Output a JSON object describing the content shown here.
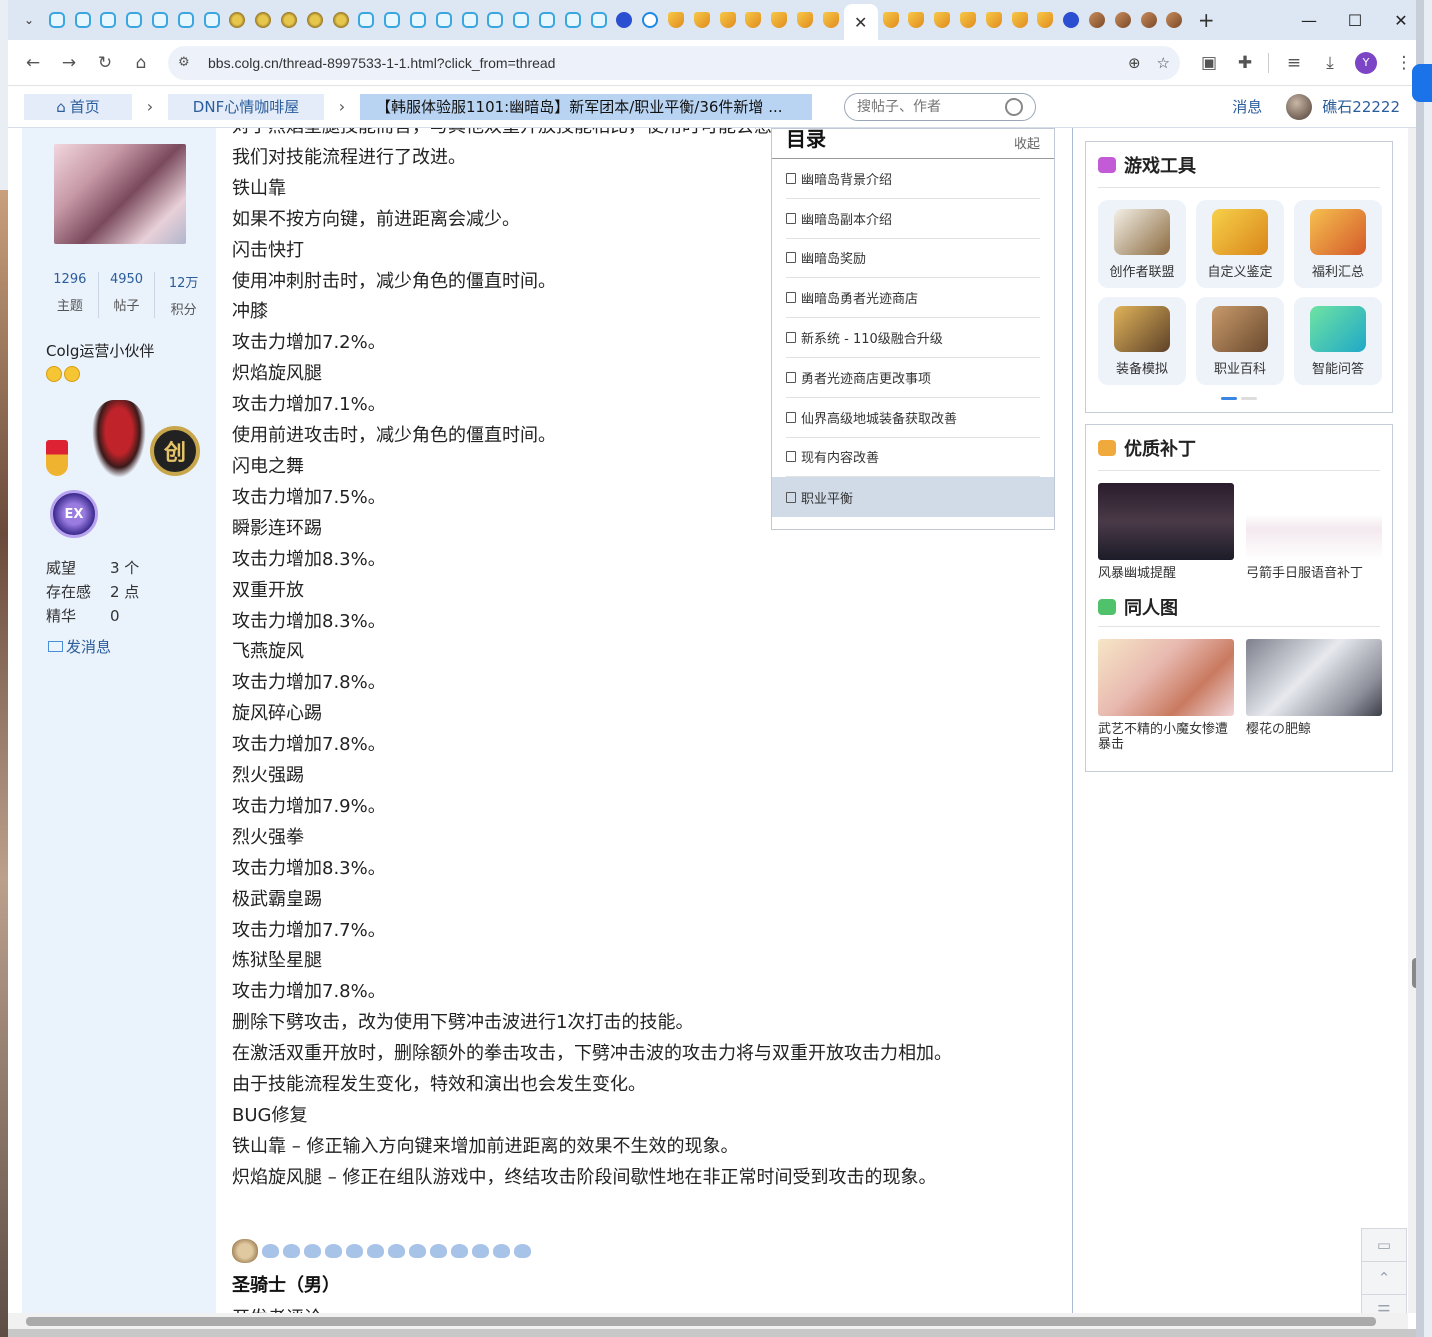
{
  "browser": {
    "tab_favicons": [
      "bili",
      "bili",
      "bili",
      "bili",
      "bili",
      "bili",
      "bili",
      "colg",
      "colg",
      "colg",
      "colg",
      "colg",
      "bili",
      "bili",
      "bili",
      "bili",
      "bili",
      "bili",
      "bili",
      "bili",
      "bili",
      "bili",
      "paw",
      "search",
      "cup",
      "cup",
      "cup",
      "cup",
      "cup",
      "cup",
      "cup"
    ],
    "tab_favicons_after": [
      "cup",
      "cup",
      "cup",
      "cup",
      "cup",
      "cup",
      "cup",
      "paw",
      "bread",
      "bread",
      "bread",
      "bread"
    ],
    "new_tab_label": "+",
    "url": "bbs.colg.cn/thread-8997533-1-1.html?click_from=thread",
    "profile_initial": "Y"
  },
  "sitenav": {
    "home_label": "首页",
    "forum_label": "DNF心情咖啡屋",
    "thread_label": "【韩服体验服1101:幽暗岛】新军团本/职业平衡/36件新增 ...",
    "search_placeholder": "搜帖子、作者",
    "messages_label": "消息",
    "username": "礁石22222"
  },
  "profile": {
    "stats": [
      {
        "value": "1296",
        "label": "主题"
      },
      {
        "value": "4950",
        "label": "帖子"
      },
      {
        "value": "12万",
        "label": "积分"
      }
    ],
    "group": "Colg运营小伙伴",
    "badge_chuang": "创",
    "badge_ex": "EX",
    "info": [
      {
        "key": "威望",
        "value": "3 个"
      },
      {
        "key": "存在感",
        "value": "2 点"
      },
      {
        "key": "精华",
        "value": "0"
      }
    ],
    "send_message": "发消息"
  },
  "post": {
    "lines": [
      "对于烈焰星腿技能而言，与其他双重开放技能相比，使用时可能会感",
      "我们对技能流程进行了改进。",
      "铁山靠",
      "如果不按方向键，前进距离会减少。",
      "闪击快打",
      "使用冲刺肘击时，减少角色的僵直时间。",
      "冲膝",
      "攻击力增加7.2%。",
      "炽焰旋风腿",
      "攻击力增加7.1%。",
      "使用前进攻击时，减少角色的僵直时间。",
      "闪电之舞",
      "攻击力增加7.5%。",
      "瞬影连环踢",
      "攻击力增加8.3%。",
      "双重开放",
      "攻击力增加8.3%。",
      "飞燕旋风",
      "攻击力增加7.8%。",
      "旋风碎心踢",
      "攻击力增加7.8%。",
      "烈火强踢",
      "攻击力增加7.9%。",
      "烈火强拳",
      "攻击力增加8.3%。",
      "极武霸皇踢",
      "攻击力增加7.7%。",
      "炼狱坠星腿",
      "攻击力增加7.8%。",
      "删除下劈攻击，改为使用下劈冲击波进行1次打击的技能。",
      "在激活双重开放时，删除额外的拳击攻击，下劈冲击波的攻击力将与双重开放攻击力相加。",
      "由于技能流程发生变化，特效和演出也会发生变化。",
      "BUG修复",
      "铁山靠 – 修正输入方向键来增加前进距离的效果不生效的现象。",
      "炽焰旋风腿 – 修正在组队游戏中，终结攻击阶段间歇性地在非正常时间受到攻击的现象。"
    ],
    "next_section_title": "圣骑士（男）",
    "next_line": "开发者评论"
  },
  "toc": {
    "title": "目录",
    "collapse_label": "收起",
    "items": [
      "幽暗岛背景介绍",
      "幽暗岛副本介绍",
      "幽暗岛奖励",
      "幽暗岛勇者光迹商店",
      "新系统 - 110级融合升级",
      "勇者光迹商店更改事项",
      "仙界高级地城装备获取改善",
      "现有内容改善",
      "职业平衡"
    ],
    "active_index": 8
  },
  "sidebar": {
    "tools_title": "游戏工具",
    "tools": [
      {
        "label": "创作者联盟",
        "icon": "book-quill-icon"
      },
      {
        "label": "自定义鉴定",
        "icon": "appraisal-icon"
      },
      {
        "label": "福利汇总",
        "icon": "gift-box-icon"
      },
      {
        "label": "装备模拟",
        "icon": "sword-shield-icon"
      },
      {
        "label": "职业百科",
        "icon": "encyclopedia-icon"
      },
      {
        "label": "智能问答",
        "icon": "ai-qa-icon"
      }
    ],
    "patches_title": "优质补丁",
    "patches": [
      {
        "caption": "风暴幽城提醒"
      },
      {
        "caption": "弓箭手日服语音补丁"
      }
    ],
    "fanart_title": "同人图",
    "fanart": [
      {
        "caption": "武艺不精的小魔女惨遭暴击"
      },
      {
        "caption": "樱花の肥鲸"
      }
    ]
  },
  "colors": {
    "accent": "#2b5d9b",
    "nav_thread_bg": "#b9d4f2",
    "profile_bg": "#eaf2fc",
    "toc_active": "#d0dbe7"
  }
}
